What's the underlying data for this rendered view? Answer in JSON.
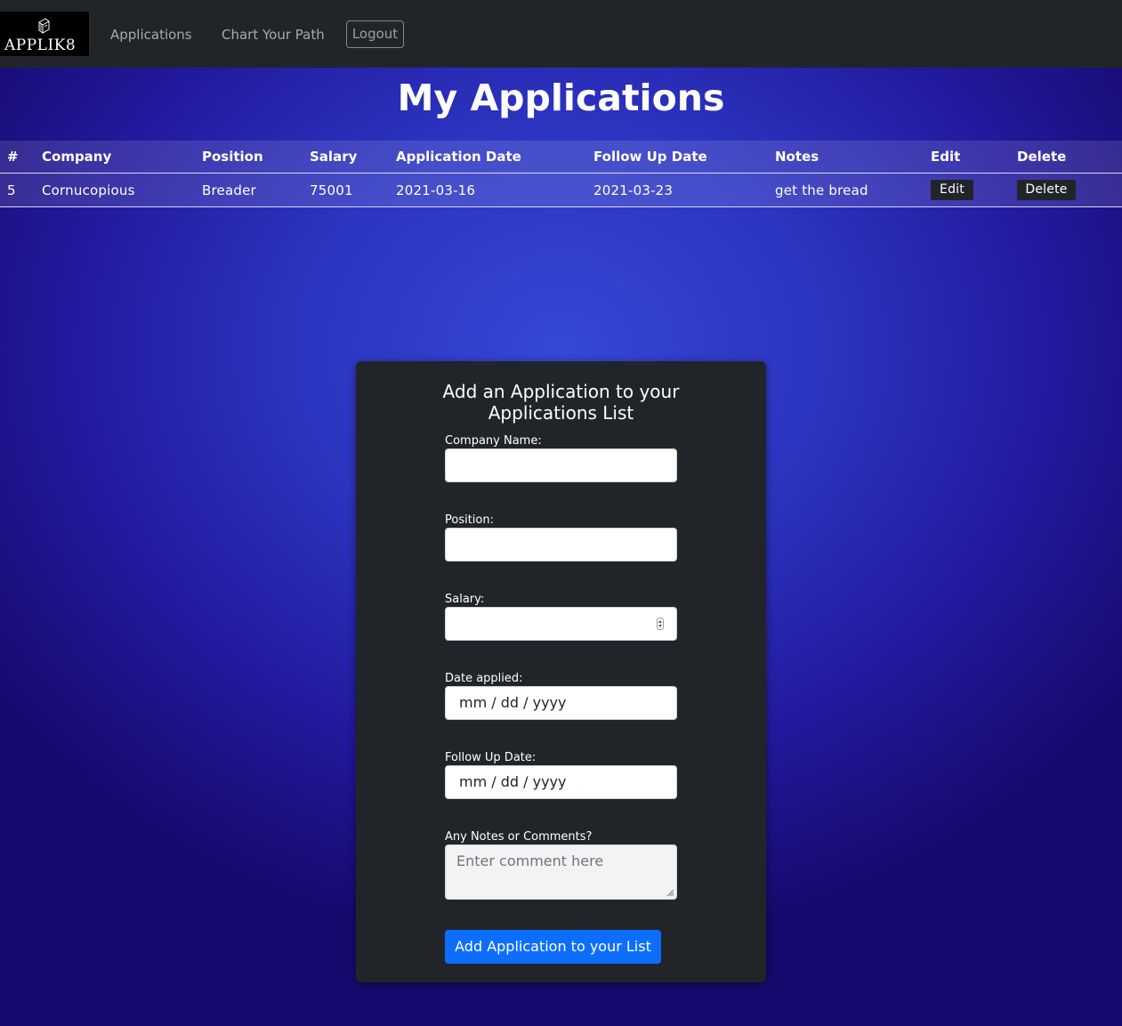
{
  "nav": {
    "brand": "APPLIK8",
    "links": [
      "Applications",
      "Chart Your Path"
    ],
    "logout_label": "Logout"
  },
  "page_title": "My Applications",
  "table": {
    "headers": [
      "#",
      "Company",
      "Position",
      "Salary",
      "Application Date",
      "Follow Up Date",
      "Notes",
      "Edit",
      "Delete"
    ],
    "rows": [
      {
        "id": "5",
        "company": "Cornucopious",
        "position": "Breader",
        "salary": "75001",
        "application_date": "2021-03-16",
        "follow_up_date": "2021-03-23",
        "notes": "get the bread",
        "edit_label": "Edit",
        "delete_label": "Delete"
      }
    ]
  },
  "form": {
    "title": "Add an Application to your Applications List",
    "company_label": "Company Name:",
    "company_value": "",
    "position_label": "Position:",
    "position_value": "",
    "salary_label": "Salary:",
    "salary_value": "",
    "date_applied_label": "Date applied:",
    "date_applied_placeholder": "mm / dd / yyyy",
    "follow_up_label": "Follow Up Date:",
    "follow_up_placeholder": "mm / dd / yyyy",
    "notes_label": "Any Notes or Comments?",
    "notes_placeholder": "Enter comment here",
    "submit_label": "Add Application to your List"
  },
  "colors": {
    "navbar": "#212529",
    "card": "#212529",
    "primary_button": "#0d6efd",
    "background_center": "#3548d6",
    "background_edge": "#160a6e"
  }
}
